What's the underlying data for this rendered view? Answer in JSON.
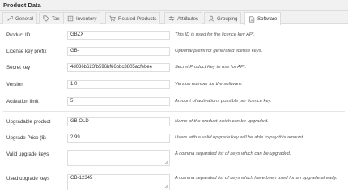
{
  "panel": {
    "title": "Product Data"
  },
  "tabs": [
    {
      "label": "General",
      "icon": "wrench-icon"
    },
    {
      "label": "Tax",
      "icon": "tag-icon"
    },
    {
      "label": "Inventory",
      "icon": "box-icon"
    },
    {
      "label": "Related Products",
      "icon": "cart-icon"
    },
    {
      "label": "Attributes",
      "icon": "attributes-icon"
    },
    {
      "label": "Grouping",
      "icon": "grouping-icon"
    },
    {
      "label": "Software",
      "icon": "document-icon",
      "active": true
    }
  ],
  "fields": {
    "product_id": {
      "label": "Product ID",
      "value": "GBZX",
      "description": "This ID is used for the licence key API."
    },
    "license_key_prefix": {
      "label": "License key prefix",
      "value": "GB-",
      "description": "Optional prefix for generated license keys."
    },
    "secret_key": {
      "label": "Secret key",
      "value": "4d036b623fb596bf66bbc3805acfebee",
      "description": "Secret Product Key to use for API."
    },
    "version": {
      "label": "Version",
      "value": "1.0",
      "description": "Version number for the software."
    },
    "activation_limit": {
      "label": "Activation limit",
      "value": "5",
      "description": "Amount of activations possible per licence key."
    },
    "upgradable_product": {
      "label": "Upgradable product",
      "value": "GB OLD",
      "description": "Name of the product which can be upgraded."
    },
    "upgrade_price": {
      "label": "Upgrade Price ($)",
      "value": "2.99",
      "description": "Users with a valid upgrade key will be able to pay this amount."
    },
    "valid_upgrade_keys": {
      "label": "Valid upgrade keys",
      "value": "",
      "description": "A comma separated list of keys which can be upgraded."
    },
    "used_upgrade_keys": {
      "label": "Used upgrade keys",
      "value": "GB-12345",
      "description": "A comma separated list of keys which have been used for an upgrade already."
    }
  },
  "colors": {
    "border": "#dddddd",
    "tab_bg": "#f1f1f1",
    "active_tab_bg": "#ffffff"
  }
}
